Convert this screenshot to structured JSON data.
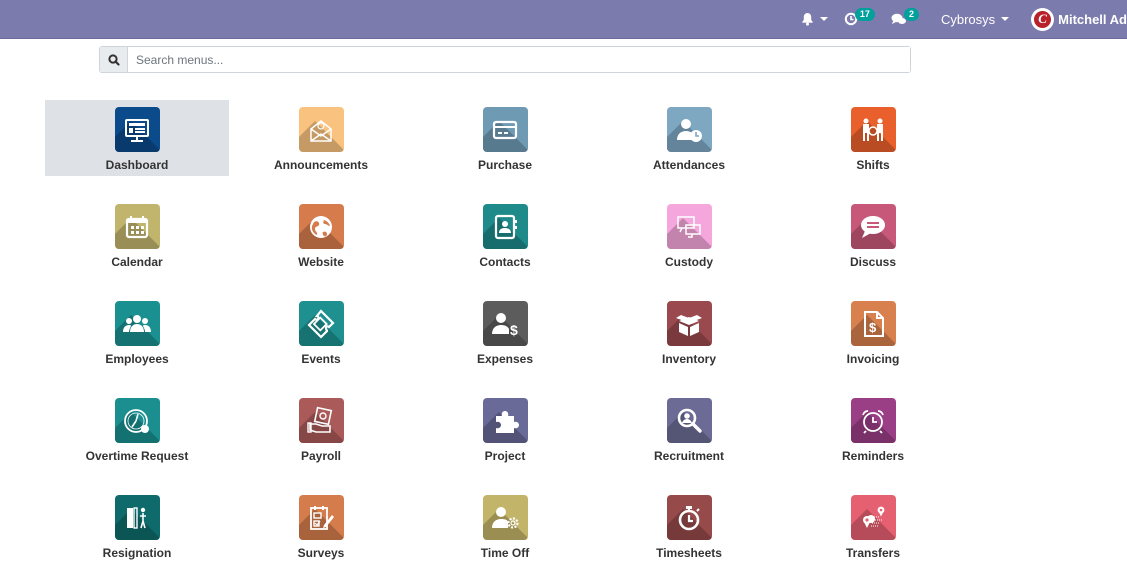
{
  "navbar": {
    "background": "#7c7bad",
    "notifications": {
      "icon": "bell-icon"
    },
    "activities": {
      "icon": "clock-icon",
      "count": "17"
    },
    "messages": {
      "icon": "chat-icon",
      "count": "2"
    },
    "company": "Cybrosys",
    "user": {
      "name": "Mitchell Ad",
      "avatar_letter": "C"
    }
  },
  "search": {
    "placeholder": "Search menus..."
  },
  "apps": [
    {
      "label": "Dashboard",
      "icon": "dashboard-monitor-icon",
      "color": "#0b4a8b",
      "active": true
    },
    {
      "label": "Announcements",
      "icon": "envelope-icon",
      "color": "#f9c27f"
    },
    {
      "label": "Purchase",
      "icon": "credit-card-icon",
      "color": "#6f9ab4"
    },
    {
      "label": "Attendances",
      "icon": "user-clock-icon",
      "color": "#7ea7c2"
    },
    {
      "label": "Shifts",
      "icon": "people-shift-icon",
      "color": "#e9602c"
    },
    {
      "label": "Calendar",
      "icon": "calendar-icon",
      "color": "#c1b46c"
    },
    {
      "label": "Website",
      "icon": "globe-icon",
      "color": "#d57b4c"
    },
    {
      "label": "Contacts",
      "icon": "address-book-icon",
      "color": "#1e8a8a"
    },
    {
      "label": "Custody",
      "icon": "monitors-icon",
      "color": "#f5a6dc"
    },
    {
      "label": "Discuss",
      "icon": "speech-bubble-icon",
      "color": "#c8587a"
    },
    {
      "label": "Employees",
      "icon": "users-icon",
      "color": "#1b9090"
    },
    {
      "label": "Events",
      "icon": "ticket-icon",
      "color": "#1f9090"
    },
    {
      "label": "Expenses",
      "icon": "user-dollar-icon",
      "color": "#5c5c5c"
    },
    {
      "label": "Inventory",
      "icon": "box-icon",
      "color": "#9a4a4e"
    },
    {
      "label": "Invoicing",
      "icon": "invoice-icon",
      "color": "#d8804e"
    },
    {
      "label": "Overtime Request",
      "icon": "gauge-icon",
      "color": "#1b8f8f"
    },
    {
      "label": "Payroll",
      "icon": "money-hand-icon",
      "color": "#ab5a5a"
    },
    {
      "label": "Project",
      "icon": "puzzle-icon",
      "color": "#6a6a98"
    },
    {
      "label": "Recruitment",
      "icon": "search-user-icon",
      "color": "#6b6b95"
    },
    {
      "label": "Reminders",
      "icon": "alarm-clock-icon",
      "color": "#9a3e86"
    },
    {
      "label": "Resignation",
      "icon": "door-exit-icon",
      "color": "#0f6b6b"
    },
    {
      "label": "Surveys",
      "icon": "clipboard-pencil-icon",
      "color": "#d47c4c"
    },
    {
      "label": "Time Off",
      "icon": "user-gear-icon",
      "color": "#c2b569"
    },
    {
      "label": "Timesheets",
      "icon": "stopwatch-icon",
      "color": "#964a4a"
    },
    {
      "label": "Transfers",
      "icon": "map-pins-icon",
      "color": "#e56070"
    }
  ]
}
